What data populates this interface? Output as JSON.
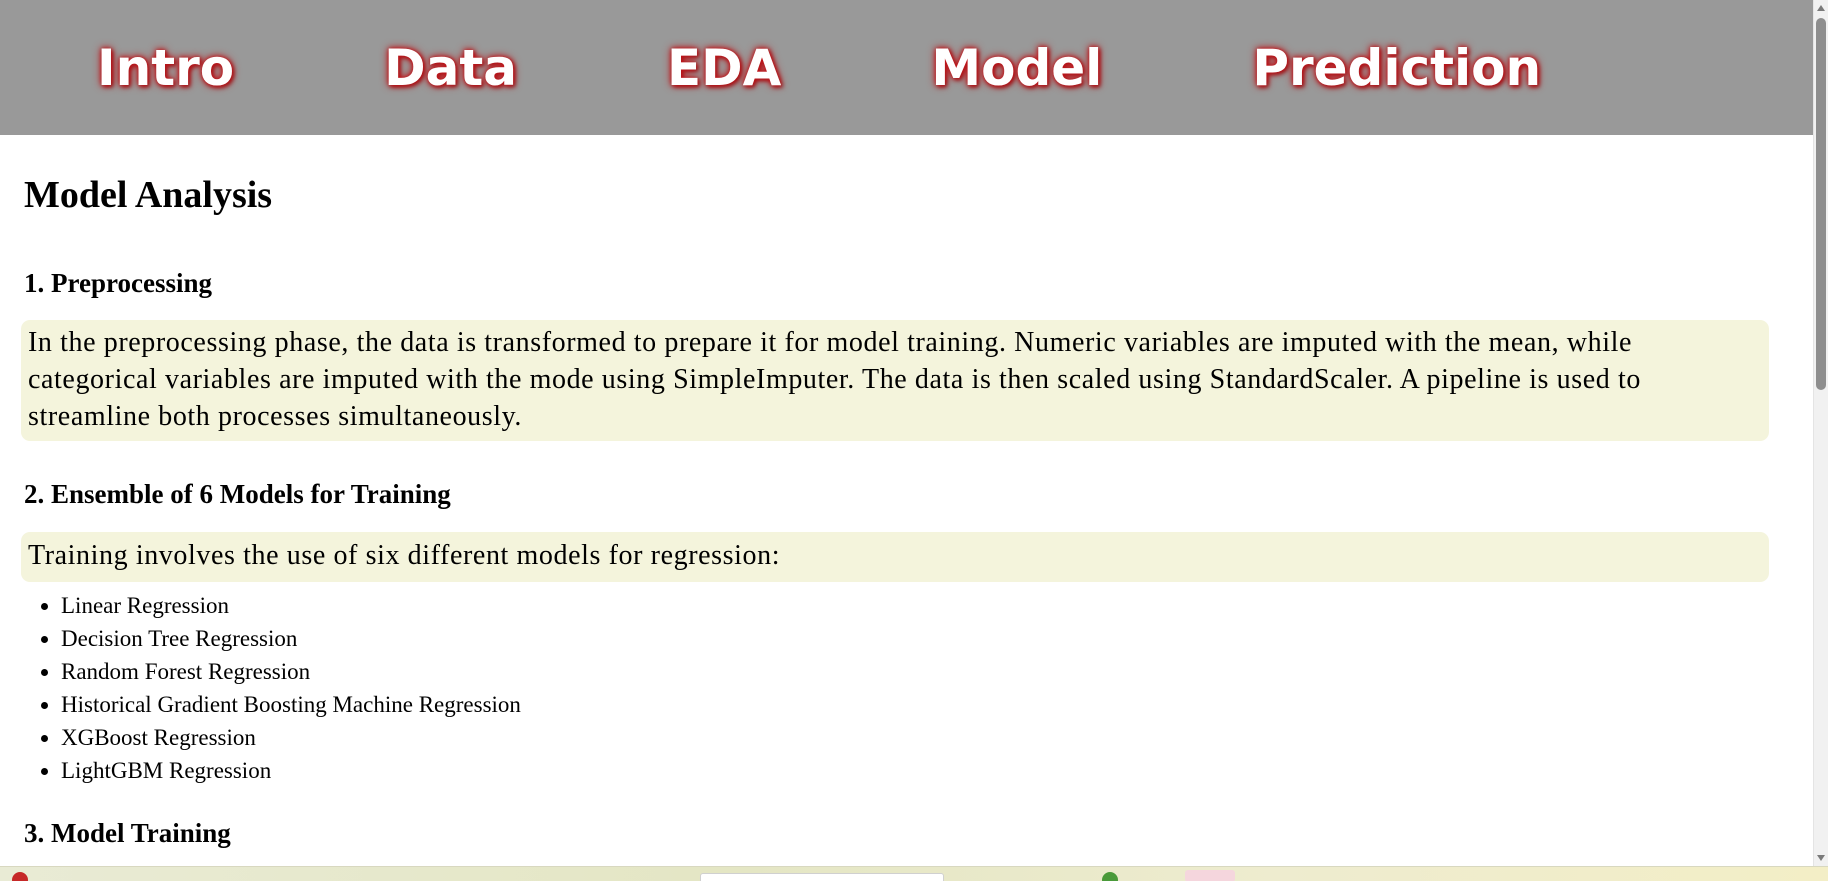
{
  "nav": {
    "items": [
      "Intro",
      "Data",
      "EDA",
      "Model",
      "Prediction"
    ]
  },
  "main": {
    "title": "Model Analysis",
    "sections": [
      {
        "heading": "1. Preprocessing",
        "text": "In the preprocessing phase, the data is transformed to prepare it for model training. Numeric variables are imputed with the mean, while categorical variables are imputed with the mode using SimpleImputer. The data is then scaled using StandardScaler. A pipeline is used to streamline both processes simultaneously."
      },
      {
        "heading": "2. Ensemble of 6 Models for Training",
        "text": "Training involves the use of six different models for regression:",
        "list": [
          "Linear Regression",
          "Decision Tree Regression",
          "Random Forest Regression",
          "Historical Gradient Boosting Machine Regression",
          "XGBoost Regression",
          "LightGBM Regression"
        ]
      },
      {
        "heading": "3. Model Training"
      }
    ]
  },
  "colors": {
    "nav_background": "#999999",
    "nav_text": "#ffffff",
    "nav_glow": "#c0151a",
    "box_background": "#f4f4dc"
  },
  "icons": {
    "scroll_up": "scroll-up-arrow-icon",
    "scroll_down": "scroll-down-arrow-icon"
  }
}
